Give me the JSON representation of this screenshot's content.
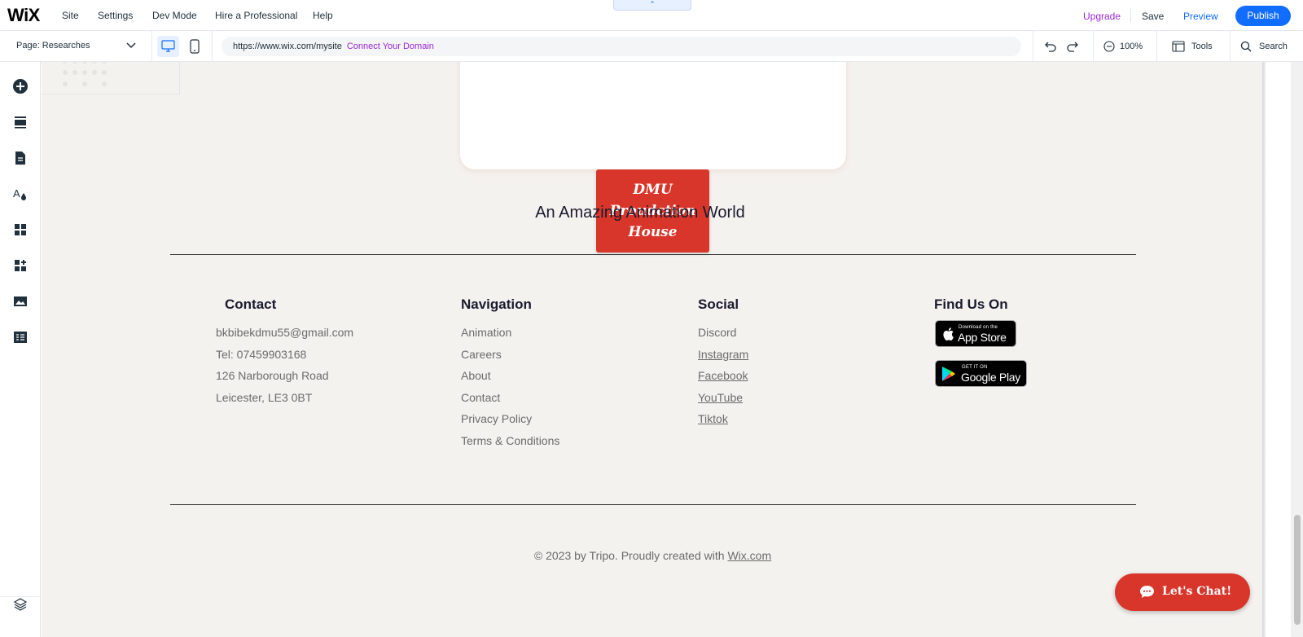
{
  "topbar": {
    "logo": "WiX",
    "menu": [
      "Site",
      "Settings",
      "Dev Mode",
      "Hire a Professional",
      "Help"
    ],
    "collapse_glyph": "⌃",
    "upgrade": "Upgrade",
    "save": "Save",
    "preview": "Preview",
    "publish": "Publish"
  },
  "toolbar": {
    "page_label": "Page: Researches",
    "url": "https://www.wix.com/mysite",
    "connect_domain": "Connect Your Domain",
    "zoom": "100%",
    "tools": "Tools",
    "search": "Search"
  },
  "sidebar": {
    "icons": [
      "add-elements-icon",
      "add-section-icon",
      "pages-icon",
      "site-design-icon",
      "apps-icon",
      "app-market-icon",
      "media-icon",
      "cms-icon"
    ],
    "bottom_icon": "layers-icon"
  },
  "site": {
    "logo_lines": [
      "DMU",
      "Proudction",
      "House"
    ],
    "tagline": "An Amazing Animation World",
    "contact": {
      "title": "Contact",
      "items": [
        "bkbibekdmu55@gmail.com",
        "Tel: 07459903168",
        "126 Narborough Road",
        "Leicester, LE3 0BT"
      ]
    },
    "navigation": {
      "title": "Navigation",
      "items": [
        "Animation",
        "Careers",
        "About",
        "Contact",
        "Privacy Policy",
        "Terms & Conditions"
      ]
    },
    "social": {
      "title": "Social",
      "items": [
        "Discord",
        "Instagram",
        "Facebook",
        "YouTube",
        "Tiktok"
      ]
    },
    "find_us": {
      "title": "Find Us On",
      "app_store_small": "Download on the",
      "app_store_big": "App Store",
      "google_small": "GET IT ON",
      "google_big": "Google Play"
    },
    "copyright_prefix": "© 2023 by Tripo. Proudly created with ",
    "copyright_link": "Wix.com",
    "chat_label": "Let's Chat!"
  },
  "colors": {
    "accent": "#116dff",
    "upgrade": "#9a27d5",
    "brand_red": "#d9362b",
    "canvas_bg": "#f4f2ef"
  }
}
